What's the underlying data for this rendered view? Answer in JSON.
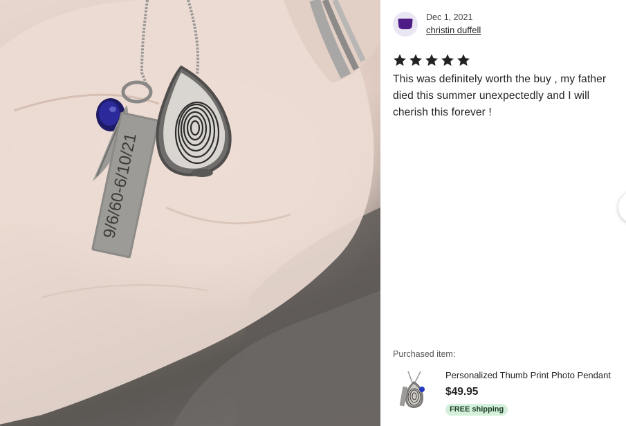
{
  "photo": {
    "engraving": "9/6/60-6/10/21"
  },
  "review": {
    "date": "Dec 1, 2021",
    "reviewer": "christin duffell",
    "rating": 5,
    "text": "This was definitely worth the buy , my father died this summer unexpectedly and I will cherish this forever !"
  },
  "purchased": {
    "label": "Purchased item:",
    "title": "Personalized Thumb Print Photo Pendant",
    "price": "$49.95",
    "shipping": "FREE shipping"
  },
  "colors": {
    "avatar_bg": "#ebe6f3",
    "avatar_fg": "#4d1d85",
    "star": "#222222",
    "shipping_bg": "#d4f0dc"
  },
  "icons": {
    "star": "star-icon",
    "avatar": "avatar-icon",
    "next": "chevron-right-icon"
  }
}
